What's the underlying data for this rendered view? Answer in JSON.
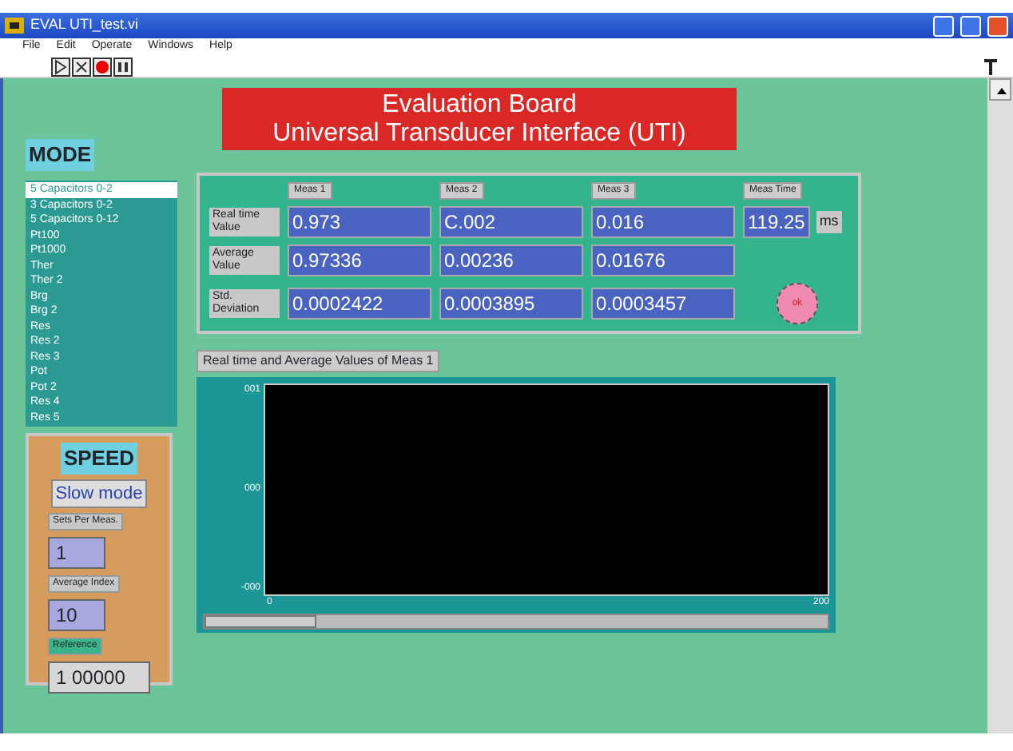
{
  "window": {
    "title": "EVAL UTI_test.vi"
  },
  "menu": [
    "File",
    "Edit",
    "Operate",
    "Windows",
    "Help"
  ],
  "banner": {
    "line1": "Evaluation Board",
    "line2": "Universal Transducer Interface (UTI)"
  },
  "mode": {
    "label": "MODE",
    "items": [
      {
        "label": "5 Capacitors 0-2",
        "selected": true
      },
      {
        "label": "3 Capacitors 0-2",
        "selected": false
      },
      {
        "label": "5 Capacitors 0-12",
        "selected": false
      },
      {
        "label": "Pt100",
        "selected": false
      },
      {
        "label": "Pt1000",
        "selected": false
      },
      {
        "label": "Ther",
        "selected": false
      },
      {
        "label": "Ther 2",
        "selected": false
      },
      {
        "label": "Brg",
        "selected": false
      },
      {
        "label": "Brg 2",
        "selected": false
      },
      {
        "label": "Res",
        "selected": false
      },
      {
        "label": "Res 2",
        "selected": false
      },
      {
        "label": "Res 3",
        "selected": false
      },
      {
        "label": "Pot",
        "selected": false
      },
      {
        "label": "Pot 2",
        "selected": false
      },
      {
        "label": "Res 4",
        "selected": false
      },
      {
        "label": "Res 5",
        "selected": false
      }
    ]
  },
  "speed": {
    "label": "SPEED",
    "mode": "Slow mode",
    "fields": [
      {
        "label": "Sets Per Meas.",
        "value": "1"
      },
      {
        "label": "Average Index",
        "value": "10"
      },
      {
        "label": "Reference",
        "value": "1 00000"
      }
    ]
  },
  "readouts": {
    "columns": [
      "Meas 1",
      "Meas 2",
      "Meas 3"
    ],
    "time_label": "Meas Time",
    "time_value": "119.25",
    "time_unit": "ms",
    "rows": [
      {
        "label": "Real time Value",
        "values": [
          "0.973",
          "C.002",
          "0.016"
        ]
      },
      {
        "label": "Average Value",
        "values": [
          "0.97336",
          "0.00236",
          "0.01676"
        ]
      },
      {
        "label": "Std. Deviation",
        "values": [
          "0.0002422",
          "0.0003895",
          "0.0003457"
        ]
      }
    ],
    "button": "ok"
  },
  "chart": {
    "title": "Real time and Average Values of Meas 1",
    "y_ticks": [
      "001",
      "000",
      "-000"
    ],
    "x_ticks": [
      "0",
      "200"
    ]
  }
}
